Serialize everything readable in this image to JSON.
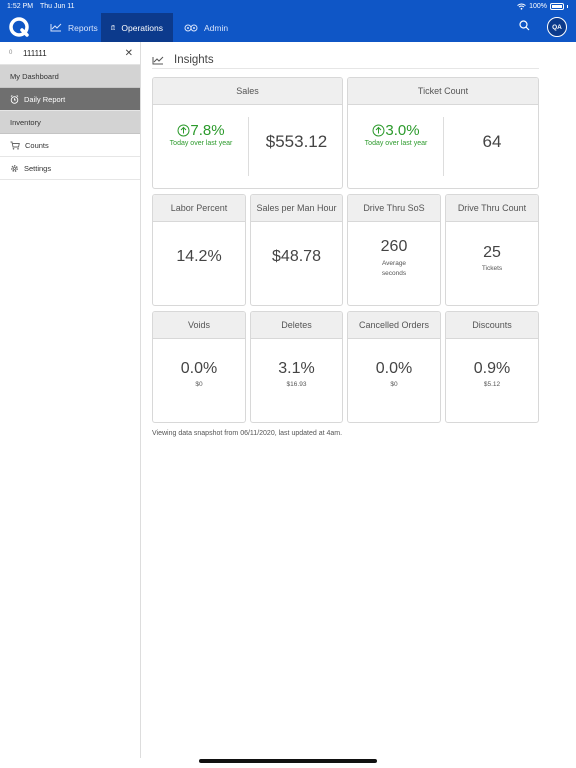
{
  "status_bar": {
    "time": "1:52 PM",
    "date": "Thu Jun 11",
    "battery": "100%"
  },
  "nav": {
    "reports": "Reports",
    "operations": "Operations",
    "admin": "Admin",
    "avatar_initials": "QA"
  },
  "sidebar": {
    "store_index": "0",
    "store_id": "111111",
    "items": [
      {
        "label": "My Dashboard",
        "kind": "group"
      },
      {
        "label": "Daily Report",
        "kind": "item",
        "active": true,
        "icon": "alarm-clock-icon"
      },
      {
        "label": "Inventory",
        "kind": "group"
      },
      {
        "label": "Counts",
        "kind": "item",
        "icon": "cart-icon"
      },
      {
        "label": "Settings",
        "kind": "item",
        "icon": "gear-icon"
      }
    ]
  },
  "insights": {
    "title": "Insights",
    "sales": {
      "title": "Sales",
      "change": "7.8%",
      "change_label": "Today over last year",
      "value": "$553.12"
    },
    "ticket_count": {
      "title": "Ticket Count",
      "change": "3.0%",
      "change_label": "Today over last year",
      "value": "64"
    },
    "labor_percent": {
      "title": "Labor Percent",
      "value": "14.2%"
    },
    "sales_per_man_hour": {
      "title": "Sales per Man Hour",
      "value": "$48.78"
    },
    "drive_thru_sos": {
      "title": "Drive Thru SoS",
      "value": "260",
      "unit": "Average seconds"
    },
    "drive_thru_count": {
      "title": "Drive Thru Count",
      "value": "25",
      "unit": "Tickets"
    },
    "voids": {
      "title": "Voids",
      "value": "0.0%",
      "amount": "$0"
    },
    "deletes": {
      "title": "Deletes",
      "value": "3.1%",
      "amount": "$16.93"
    },
    "cancelled_orders": {
      "title": "Cancelled Orders",
      "value": "0.0%",
      "amount": "$0"
    },
    "discounts": {
      "title": "Discounts",
      "value": "0.9%",
      "amount": "$5.12"
    },
    "snapshot_note": "Viewing data snapshot from 06/11/2020, last updated at 4am."
  },
  "colors": {
    "brand": "#0f56c6",
    "nav_active": "#0c3a8c",
    "positive": "#2c9a2c"
  }
}
